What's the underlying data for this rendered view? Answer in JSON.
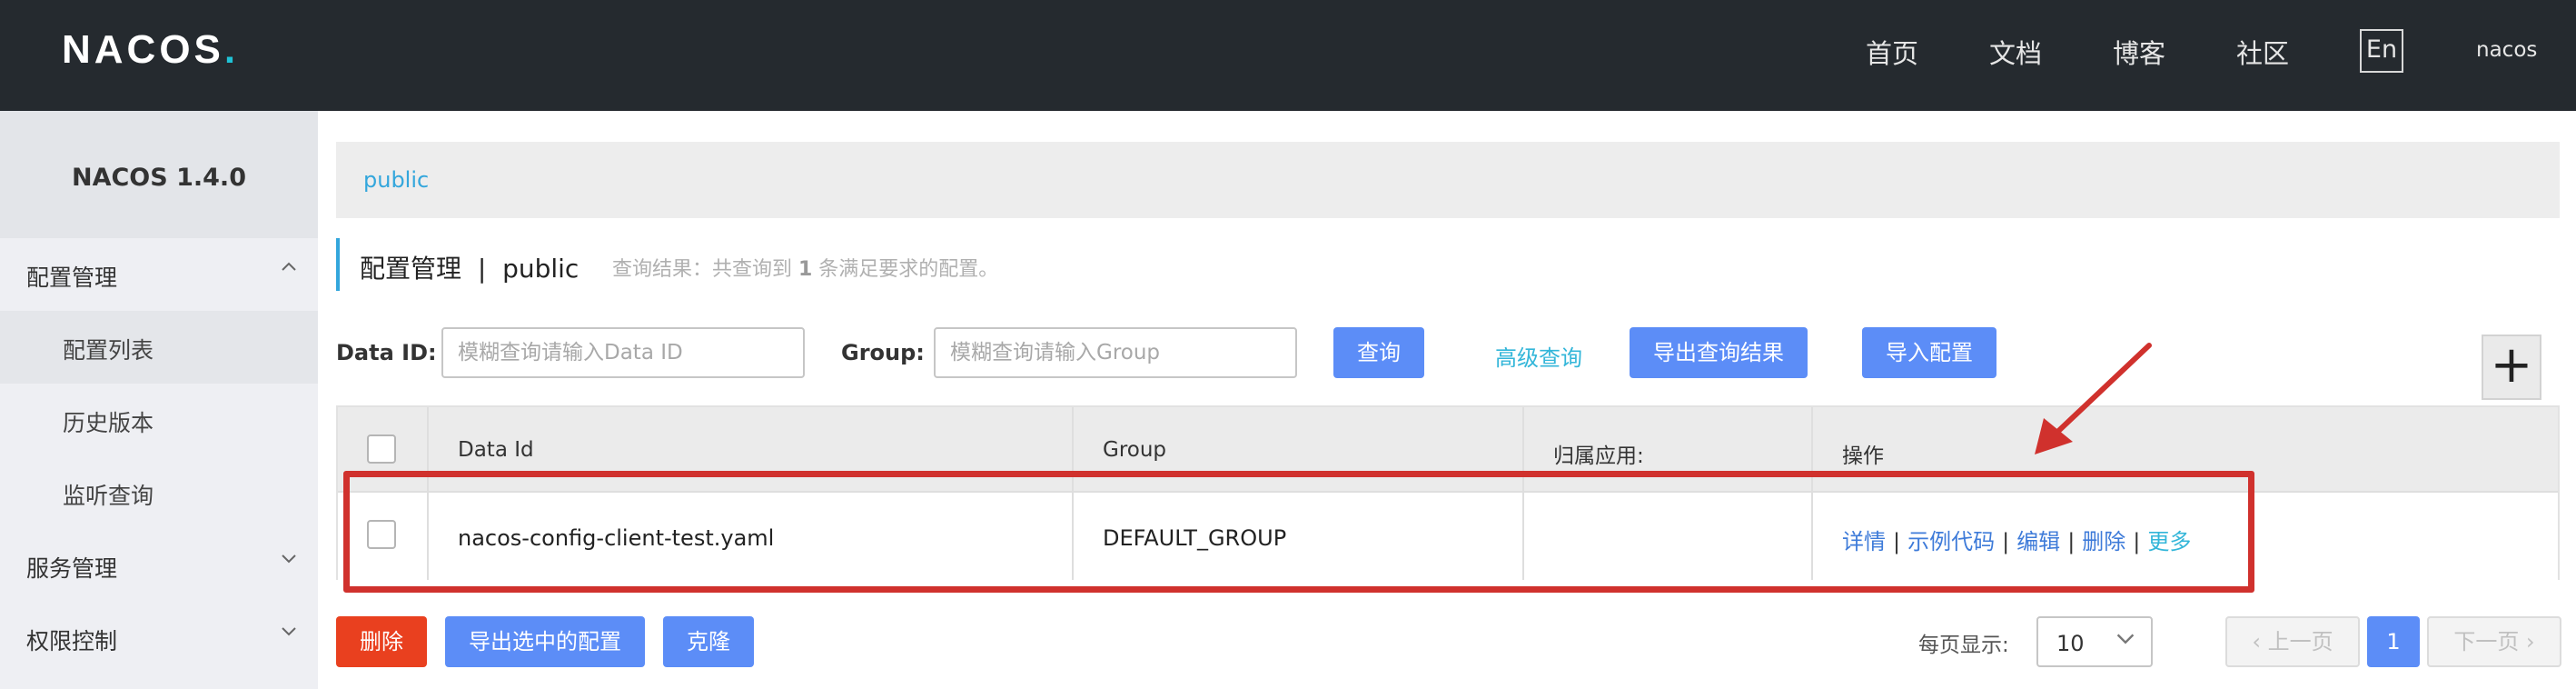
{
  "header": {
    "logo": "NACOS",
    "logo_dot": ".",
    "nav": [
      "首页",
      "文档",
      "博客",
      "社区"
    ],
    "lang": "En",
    "user": "nacos"
  },
  "sidebar": {
    "version": "NACOS 1.4.0",
    "groups": [
      {
        "label": "配置管理",
        "chevron": "chevron-up-icon"
      },
      {
        "label": "服务管理",
        "chevron": "chevron-down-icon"
      },
      {
        "label": "权限控制",
        "chevron": "chevron-down-icon"
      }
    ],
    "items": [
      "配置列表",
      "历史版本",
      "监听查询"
    ]
  },
  "namespace": {
    "tab": "public"
  },
  "page": {
    "title": "配置管理",
    "title_sep": "|",
    "namespace": "public",
    "result_prefix": "查询结果：共查询到 ",
    "result_count": "1",
    "result_suffix": " 条满足要求的配置。"
  },
  "filters": {
    "data_id_label": "Data ID:",
    "data_id_placeholder": "模糊查询请输入Data ID",
    "data_id_value": "",
    "group_label": "Group:",
    "group_placeholder": "模糊查询请输入Group",
    "group_value": "",
    "query_button": "查询",
    "advanced_query": "高级查询",
    "export_results_button": "导出查询结果",
    "import_button": "导入配置",
    "add_button": "+"
  },
  "table": {
    "headers": [
      "Data Id",
      "Group",
      "归属应用:",
      "操作"
    ],
    "rows": [
      {
        "data_id": "nacos-config-client-test.yaml",
        "group": "DEFAULT_GROUP",
        "app": "",
        "ops": [
          "详情",
          "示例代码",
          "编辑",
          "删除",
          "更多"
        ]
      }
    ],
    "op_separator": "|"
  },
  "footer": {
    "delete_button": "删除",
    "export_selected_button": "导出选中的配置",
    "clone_button": "克隆",
    "per_page_label": "每页显示:",
    "per_page_value": "10",
    "prev_page": "上一页",
    "current_page": "1",
    "next_page": "下一页"
  },
  "colors": {
    "header_bg": "#252a2f",
    "accent_blue": "#5c8df7",
    "link_cyan": "#33b6d9",
    "danger_red": "#e9401f",
    "annotation_red": "#d0312d"
  }
}
